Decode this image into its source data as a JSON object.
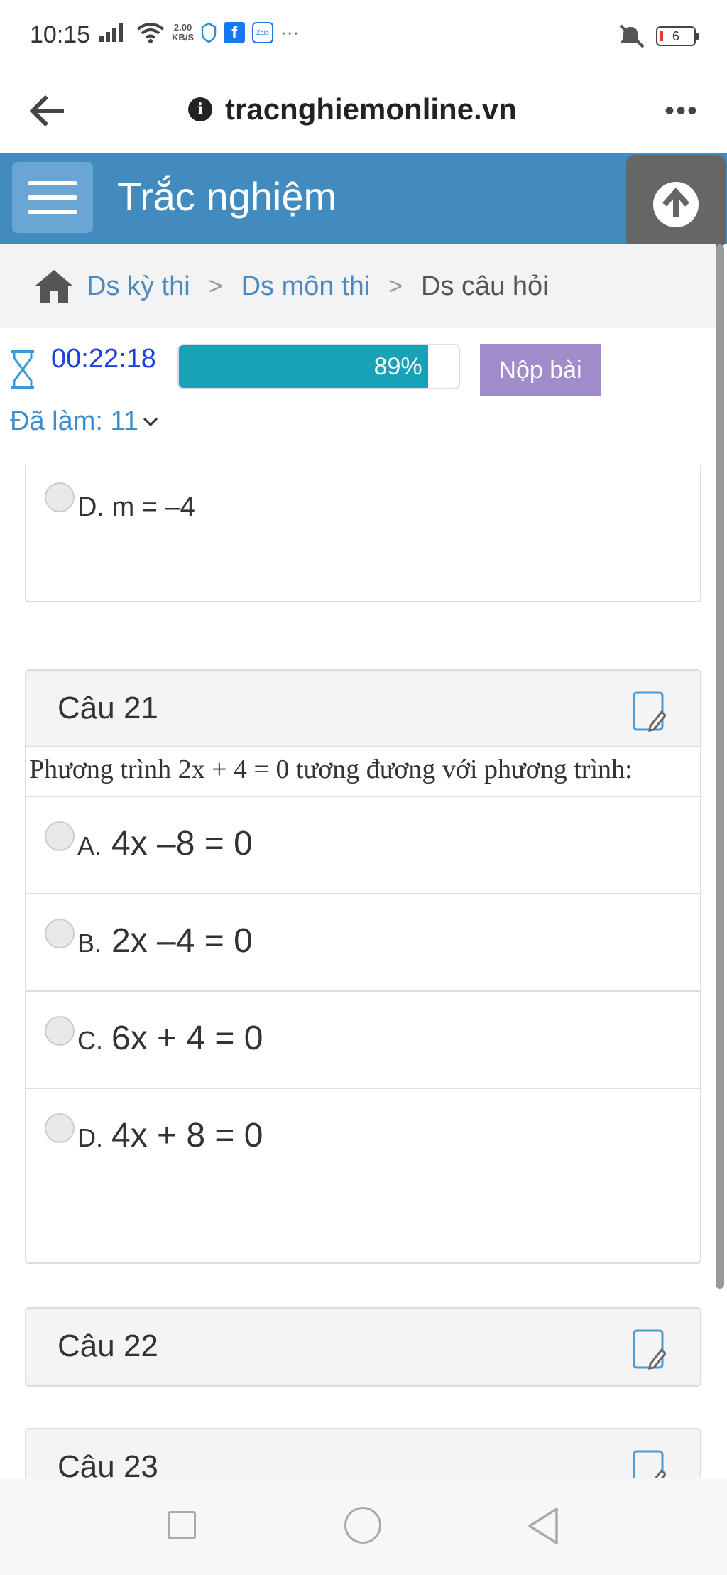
{
  "status_bar": {
    "time": "10:15",
    "net_speed_value": "2.00",
    "net_speed_unit": "KB/S",
    "fb_icon_letter": "f",
    "zalo_icon_text": "Zalo",
    "more_dots": "···",
    "battery": "6"
  },
  "browser": {
    "url": "tracnghiemonline.vn",
    "info_icon": "i",
    "menu": "•••"
  },
  "app": {
    "title": "Trắc nghiệm"
  },
  "breadcrumb": {
    "items": [
      "Ds kỳ thi",
      "Ds môn thi"
    ],
    "current": "Ds câu hỏi",
    "separator": ">"
  },
  "exam": {
    "time_left": "00:22:18",
    "progress_label": "89%",
    "progress_fraction": 0.89,
    "submit_label": "Nộp bài",
    "done_label": "Đã làm: 11",
    "done_chevron": "⌄"
  },
  "prev_card": {
    "option_letter": "D.",
    "option_text": "m = –4"
  },
  "q21": {
    "title": "Câu 21",
    "text": "Phương trình 2x + 4 = 0 tương đương với phương trình:",
    "options": [
      {
        "letter": "A.",
        "text": "4x –8 = 0"
      },
      {
        "letter": "B.",
        "text": "2x –4 = 0"
      },
      {
        "letter": "C.",
        "text": "6x + 4 = 0"
      },
      {
        "letter": "D.",
        "text": "4x + 8 = 0"
      }
    ]
  },
  "q22": {
    "title": "Câu 22"
  },
  "q23": {
    "title": "Câu 23"
  },
  "colors": {
    "header": "#428bbf",
    "progress": "#17a2b8",
    "submit": "#a08bcb",
    "link": "#4a8ac0"
  }
}
